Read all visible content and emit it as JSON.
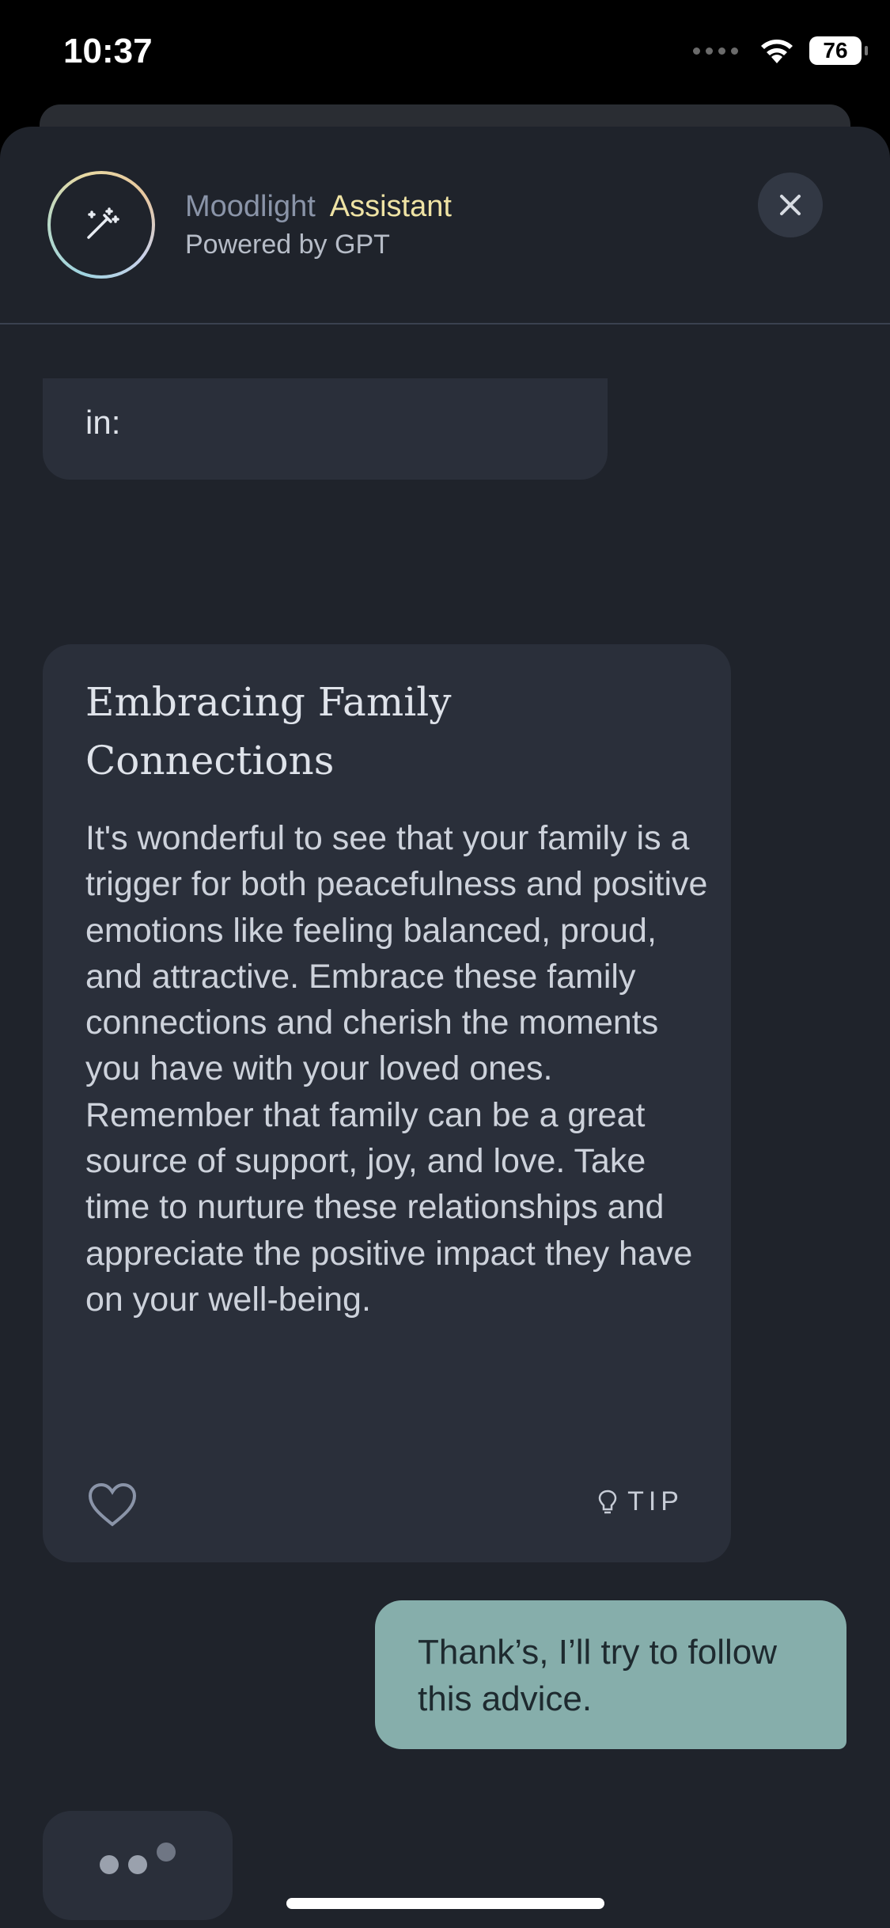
{
  "status_bar": {
    "time": "10:37",
    "battery": "76"
  },
  "header": {
    "app_name": "Moodlight",
    "assistant_label": "Assistant",
    "powered_by": "Powered by GPT"
  },
  "chat": {
    "previous_message_tail": "in:",
    "card": {
      "title": "Embracing Family Connections",
      "body": "It's wonderful to see that your family is a trigger for both peacefulness and positive emotions like feeling balanced, proud, and attractive. Embrace these family connections and cherish the moments you have with your loved ones. Remember that family can be a great source of support, joy, and love. Take time to nurture these relationships and appreciate the positive impact they have on your well-being.",
      "tip_label": "TIP"
    },
    "user_message": "Thank’s, I’ll try to follow this advice."
  },
  "colors": {
    "background": "#1f232b",
    "bubble": "#2a2f3a",
    "user_bubble": "#86aeab",
    "assistant_accent": "#efe3a4"
  }
}
